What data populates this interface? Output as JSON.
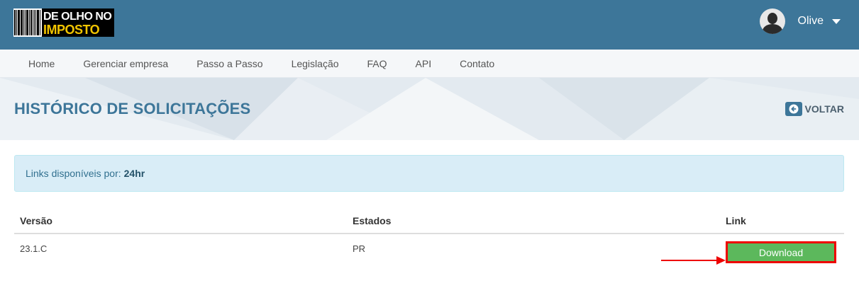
{
  "brand": {
    "logo_line1": "DE OLHO NO",
    "logo_line2": "IMPOSTO",
    "logo_icon": "barcode-icon"
  },
  "user": {
    "name": "Olive",
    "avatar_icon": "user-avatar-icon",
    "menu_icon": "caret-down-icon"
  },
  "nav": {
    "items": [
      {
        "label": "Home"
      },
      {
        "label": "Gerenciar empresa"
      },
      {
        "label": "Passo a Passo"
      },
      {
        "label": "Legislação"
      },
      {
        "label": "FAQ"
      },
      {
        "label": "API"
      },
      {
        "label": "Contato"
      }
    ]
  },
  "page": {
    "title": "HISTÓRICO DE SOLICITAÇÕES",
    "back_label": "VOLTAR",
    "back_icon": "arrow-left-icon"
  },
  "alert": {
    "text": "Links disponíveis por:",
    "value": "24hr"
  },
  "table": {
    "headers": [
      "Versão",
      "Estados",
      "Link"
    ],
    "rows": [
      {
        "versao": "23.1.C",
        "estados": "PR",
        "link_label": "Download"
      }
    ]
  },
  "colors": {
    "topbar": "#3d7699",
    "title": "#3d7699",
    "download_button": "#5cb85c",
    "highlight": "#ee0000"
  }
}
